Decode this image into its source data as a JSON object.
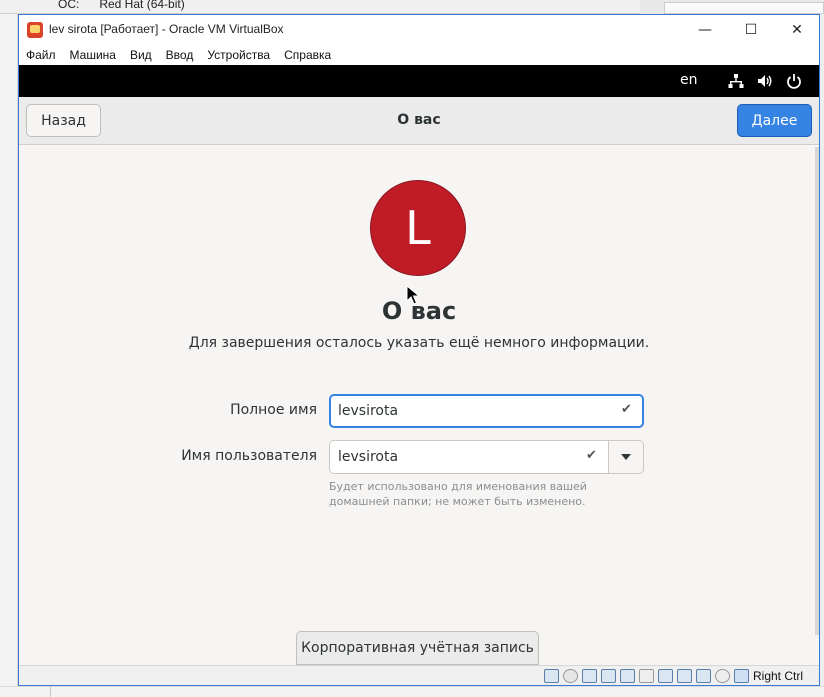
{
  "host": {
    "os_label": "ОС:      Red Hat (64-bit)"
  },
  "window": {
    "title": "lev sirota [Работает] - Oracle VM VirtualBox",
    "minimize": "—",
    "maximize": "☐",
    "close": "✕"
  },
  "menu": [
    "Файл",
    "Машина",
    "Вид",
    "Ввод",
    "Устройства",
    "Справка"
  ],
  "guest_topbar": {
    "language": "en",
    "icons": [
      "network-icon",
      "volume-icon",
      "power-icon"
    ]
  },
  "headerbar": {
    "back_label": "Назад",
    "title": "О вас",
    "next_label": "Далее"
  },
  "page": {
    "avatar_letter": "L",
    "avatar_color": "#c01c28",
    "title": "О вас",
    "subtitle": "Для завершения осталось указать ещё немного информации."
  },
  "form": {
    "full_name_label": "Полное имя",
    "full_name_value": "levsirota",
    "username_label": "Имя пользователя",
    "username_value": "levsirota",
    "hint": "Будет использовано для именования вашей домашней папки; не может быть изменено."
  },
  "enterprise_button": "Корпоративная учётная запись",
  "statusbar": {
    "host_key": "Right Ctrl"
  },
  "colors": {
    "accent": "#3584e4",
    "topbar": "#000000"
  }
}
